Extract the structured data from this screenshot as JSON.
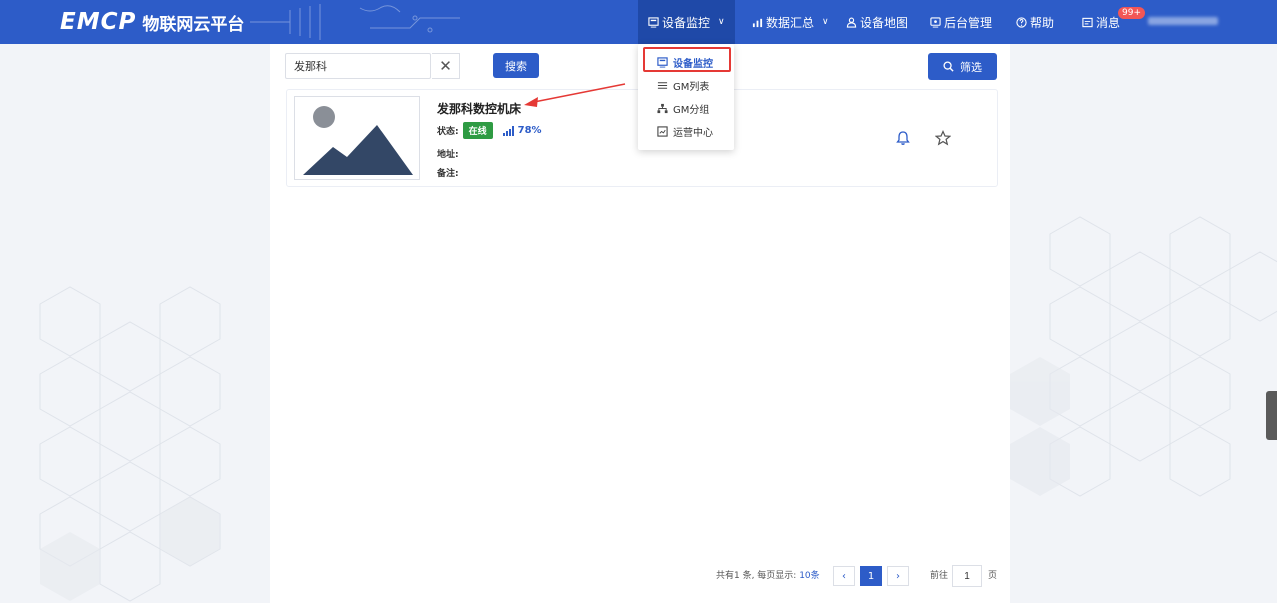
{
  "header": {
    "logo_mark": "EMCP",
    "logo_text": "物联网云平台",
    "nav": {
      "device_monitor": "设备监控",
      "data_summary": "数据汇总",
      "device_map": "设备地图",
      "backend": "后台管理",
      "help": "帮助",
      "messages": "消息",
      "messages_badge": "99+"
    }
  },
  "dropdown": {
    "items": [
      {
        "label": "设备监控",
        "icon": "monitor-icon"
      },
      {
        "label": "GM列表",
        "icon": "list-icon"
      },
      {
        "label": "GM分组",
        "icon": "group-icon"
      },
      {
        "label": "运营中心",
        "icon": "operations-icon"
      }
    ]
  },
  "search": {
    "value": "发那科",
    "button": "搜索",
    "filter": "筛选"
  },
  "device": {
    "name": "发那科数控机床",
    "status_label": "状态:",
    "status": "在线",
    "signal": "78%",
    "address_label": "地址:",
    "note_label": "备注:"
  },
  "pagination": {
    "summary_prefix": "共有1 条, 每页显示: ",
    "page_size": "10条",
    "current": "1",
    "goto_label": "前往",
    "goto_value": "1",
    "page_suffix": "页"
  },
  "colors": {
    "primary": "#2d5cc8",
    "online": "#2e9b43",
    "highlight": "#e53935"
  }
}
